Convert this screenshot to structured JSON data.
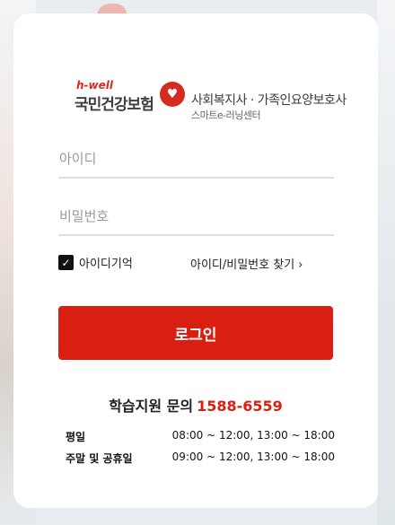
{
  "logo": {
    "hwell": "h-well",
    "nhis": "국민건강보험",
    "org_line1": "사회복지사 · 가족인요양보호사",
    "org_line2": "스마트e-러닝센터"
  },
  "login": {
    "id_placeholder": "아이디",
    "pw_placeholder": "비밀번호",
    "remember_label": "아이디기억",
    "remember_checked": true,
    "find_label": "아이디/비밀번호 찾기",
    "submit_label": "로그인"
  },
  "support": {
    "title": "학습지원 문의",
    "phone": "1588-6559",
    "weekday_label": "평일",
    "weekday_hours": "08:00 ~ 12:00, 13:00 ~ 18:00",
    "weekend_label": "주말 및 공휴일",
    "weekend_hours": "09:00 ~ 12:00, 13:00 ~ 18:00"
  },
  "colors": {
    "accent": "#d81f12",
    "card_bg": "#ffffff"
  },
  "icons": {
    "check": "check-icon",
    "chevron": "chevron-right-icon",
    "heart": "heart-icon"
  }
}
